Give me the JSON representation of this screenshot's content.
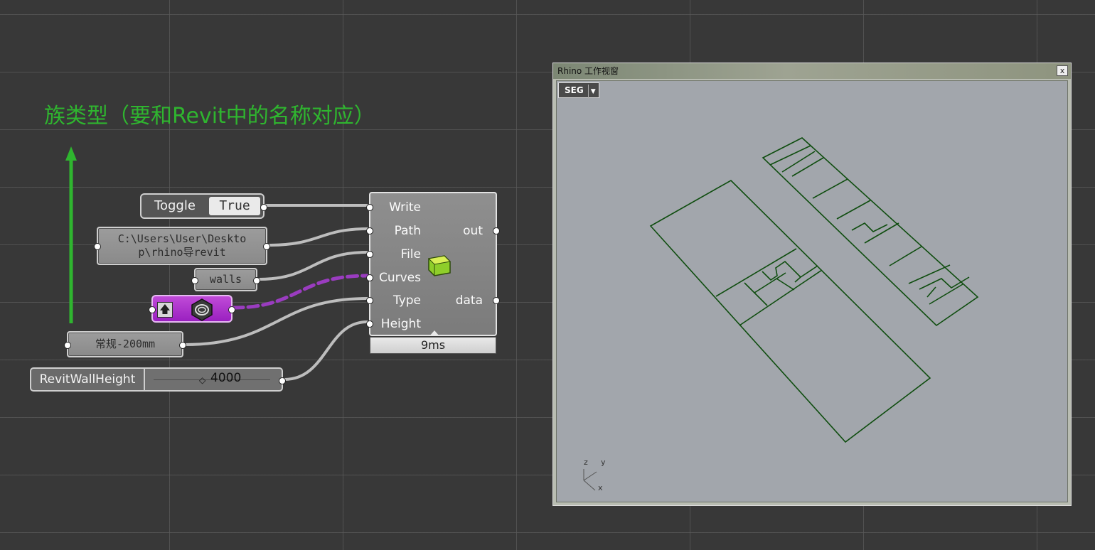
{
  "annotation": {
    "text": "族类型（要和Revit中的名称对应）",
    "color": "#2fb52f"
  },
  "toggle": {
    "label": "Toggle",
    "value": "True"
  },
  "path_panel": {
    "text_line1": "C:\\Users\\User\\Deskto",
    "text_line2": "p\\rhino导revit"
  },
  "walls_panel": {
    "text": "walls"
  },
  "geometry_param": {
    "icon": "curve-geometry-icon",
    "color": "#b02fd0"
  },
  "type_panel": {
    "text": "常规-200mm"
  },
  "slider": {
    "name": "RevitWallHeight",
    "value": "4000"
  },
  "component": {
    "inputs": [
      "Write",
      "Path",
      "File",
      "Curves",
      "Type",
      "Height"
    ],
    "outputs": [
      "out",
      "data"
    ],
    "icon": "revit-export-icon",
    "timer": "9ms"
  },
  "rhino_window": {
    "title": "Rhino 工作视窗",
    "view_tab": "SEG",
    "close_label": "x",
    "axes": {
      "z": "z",
      "y": "y",
      "x": "x"
    },
    "curve_color": "#0f4d0f"
  }
}
